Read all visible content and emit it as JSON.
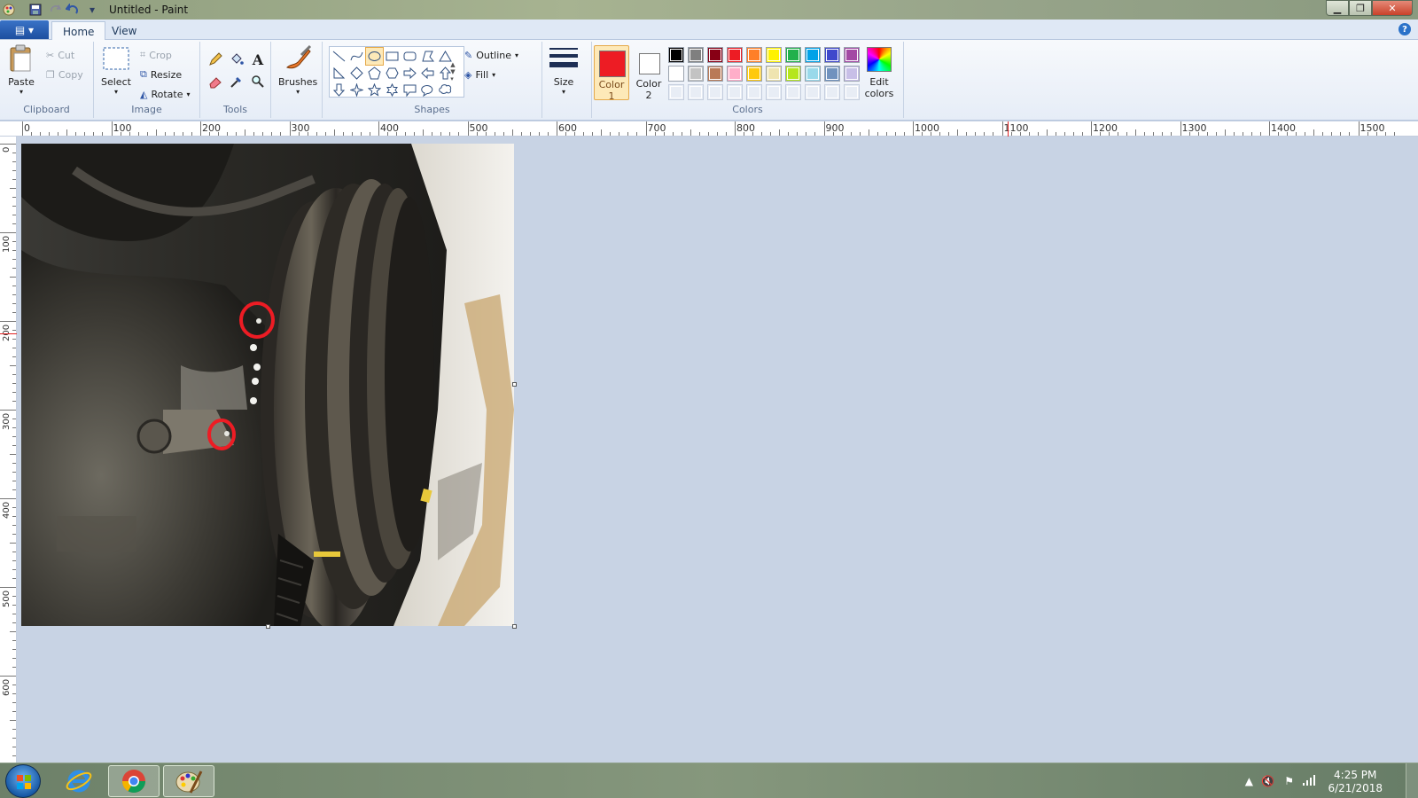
{
  "window": {
    "title": "Untitled - Paint"
  },
  "tabs": [
    {
      "label": "Home",
      "active": true
    },
    {
      "label": "View",
      "active": false
    }
  ],
  "ribbon": {
    "clipboard": {
      "label": "Clipboard",
      "paste": "Paste",
      "cut": "Cut",
      "copy": "Copy"
    },
    "image": {
      "label": "Image",
      "select": "Select",
      "crop": "Crop",
      "resize": "Resize",
      "rotate": "Rotate"
    },
    "tools": {
      "label": "Tools"
    },
    "brushes": {
      "label": "Brushes"
    },
    "shapes": {
      "label": "Shapes",
      "outline": "Outline",
      "fill": "Fill"
    },
    "size": {
      "label": "Size"
    },
    "colors": {
      "label": "Colors",
      "color1_line1": "Color",
      "color1_line2": "1",
      "color2_line1": "Color",
      "color2_line2": "2",
      "edit_line1": "Edit",
      "edit_line2": "colors",
      "color1_value": "#ed1c24",
      "color2_value": "#ffffff",
      "palette_row1": [
        "#000000",
        "#7f7f7f",
        "#880015",
        "#ed1c24",
        "#ff7f27",
        "#fff200",
        "#22b14c",
        "#00a2e8",
        "#3f48cc",
        "#a349a4"
      ],
      "palette_row2": [
        "#ffffff",
        "#c3c3c3",
        "#b97a57",
        "#ffaec9",
        "#ffc90e",
        "#efe4b0",
        "#b5e61d",
        "#99d9ea",
        "#7092be",
        "#c8bfe7"
      ]
    }
  },
  "rulers": {
    "horizontal": [
      "0",
      "100",
      "200",
      "300",
      "400",
      "500",
      "600",
      "700",
      "800",
      "900",
      "1000",
      "1100",
      "1200",
      "1300",
      "1400",
      "1500"
    ],
    "vertical": [
      "0",
      "100",
      "200",
      "300",
      "400",
      "500",
      "600"
    ]
  },
  "taskbar": {
    "time": "4:25 PM",
    "date": "6/21/2018"
  }
}
